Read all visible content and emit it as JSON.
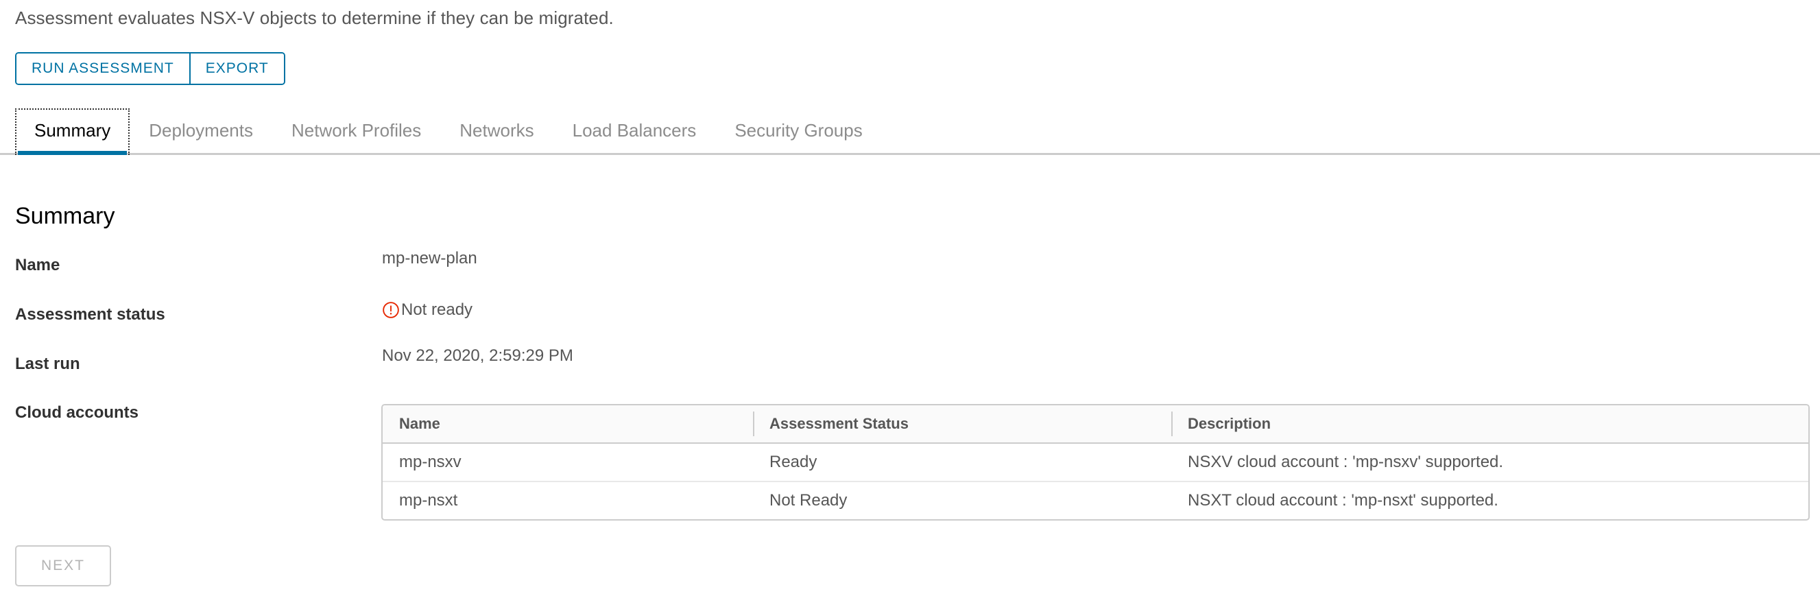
{
  "intro": {
    "text": "Assessment evaluates NSX-V objects to determine if they can be migrated."
  },
  "toolbar": {
    "run_assessment_label": "RUN ASSESSMENT",
    "export_label": "EXPORT"
  },
  "tabs": [
    {
      "label": "Summary",
      "active": true
    },
    {
      "label": "Deployments",
      "active": false
    },
    {
      "label": "Network Profiles",
      "active": false
    },
    {
      "label": "Networks",
      "active": false
    },
    {
      "label": "Load Balancers",
      "active": false
    },
    {
      "label": "Security Groups",
      "active": false
    }
  ],
  "summary": {
    "heading": "Summary",
    "name_label": "Name",
    "name_value": "mp-new-plan",
    "status_label": "Assessment status",
    "status_value": "Not ready",
    "status_icon": "error-circle-icon",
    "status_color": "#e62700",
    "last_run_label": "Last run",
    "last_run_value": "Nov 22, 2020, 2:59:29 PM",
    "cloud_accounts_label": "Cloud accounts"
  },
  "cloud_accounts_table": {
    "columns": [
      "Name",
      "Assessment Status",
      "Description"
    ],
    "rows": [
      {
        "name": "mp-nsxv",
        "status": "Ready",
        "description": "NSXV cloud account : 'mp-nsxv' supported."
      },
      {
        "name": "mp-nsxt",
        "status": "Not Ready",
        "description": "NSXT cloud account : 'mp-nsxt' supported."
      }
    ]
  },
  "footer": {
    "next_label": "NEXT"
  },
  "colors": {
    "accent": "#0072a3",
    "danger": "#e62700",
    "border": "#cccccc",
    "text": "#565656"
  }
}
